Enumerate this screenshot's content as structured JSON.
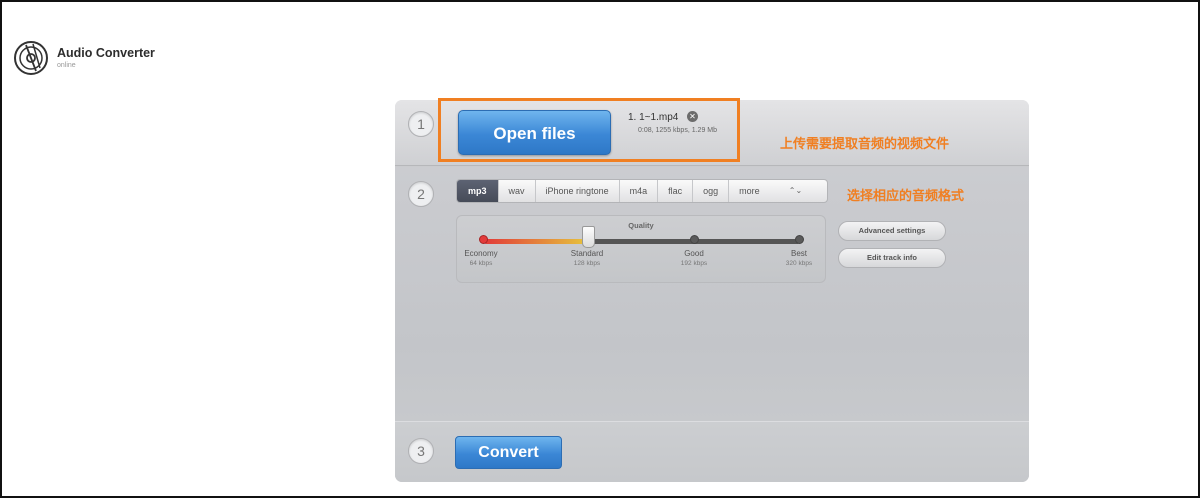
{
  "brand": {
    "title": "Audio Converter",
    "subtitle": "online"
  },
  "steps": {
    "one": "1",
    "two": "2",
    "three": "3"
  },
  "upload": {
    "button_label": "Open files",
    "file_name": "1. 1~1.mp4",
    "remove_glyph": "✕",
    "file_meta": "0:08, 1255 kbps, 1.29 Mb"
  },
  "annotations": {
    "upload_note": "上传需要提取音频的视频文件",
    "format_note": "选择相应的音频格式"
  },
  "formats": {
    "items": [
      "mp3",
      "wav",
      "iPhone ringtone",
      "m4a",
      "flac",
      "ogg",
      "more"
    ],
    "selected": "mp3",
    "more_arrows": "⌃⌄"
  },
  "quality": {
    "title": "Quality",
    "levels": [
      {
        "name": "Economy",
        "bitrate": "64 kbps"
      },
      {
        "name": "Standard",
        "bitrate": "128 kbps"
      },
      {
        "name": "Good",
        "bitrate": "192 kbps"
      },
      {
        "name": "Best",
        "bitrate": "320 kbps"
      }
    ],
    "selected": "Standard",
    "selected_fraction": 0.333
  },
  "side_buttons": {
    "advanced": "Advanced settings",
    "track_info": "Edit track info"
  },
  "convert": {
    "button_label": "Convert"
  },
  "colors": {
    "accent": "#3b87d6",
    "annotation": "#f07f22",
    "slider_start": "#e23a3a",
    "slider_end": "#e6c63c"
  },
  "icons": {
    "logo": "record-disc-icon"
  }
}
